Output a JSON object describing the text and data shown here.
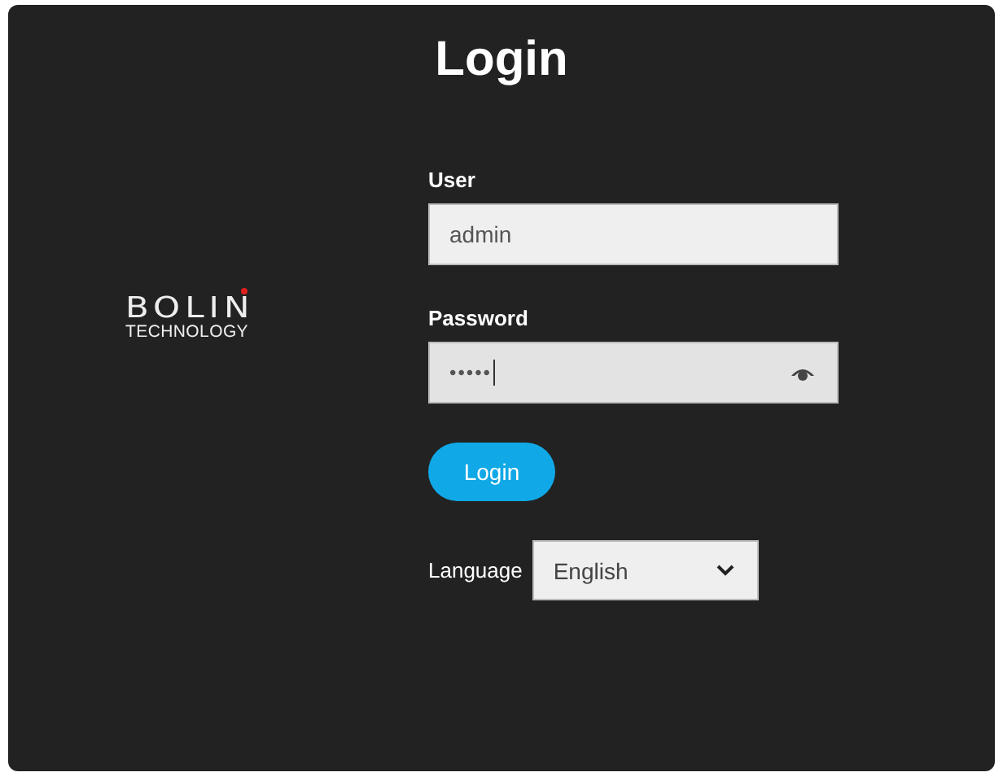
{
  "title": "Login",
  "logo": {
    "name": "BOLIN",
    "tagline": "TECHNOLOGY"
  },
  "user": {
    "label": "User",
    "value": "admin"
  },
  "password": {
    "label": "Password",
    "value": "•••••"
  },
  "login_button": "Login",
  "language": {
    "label": "Language",
    "value": "English"
  }
}
